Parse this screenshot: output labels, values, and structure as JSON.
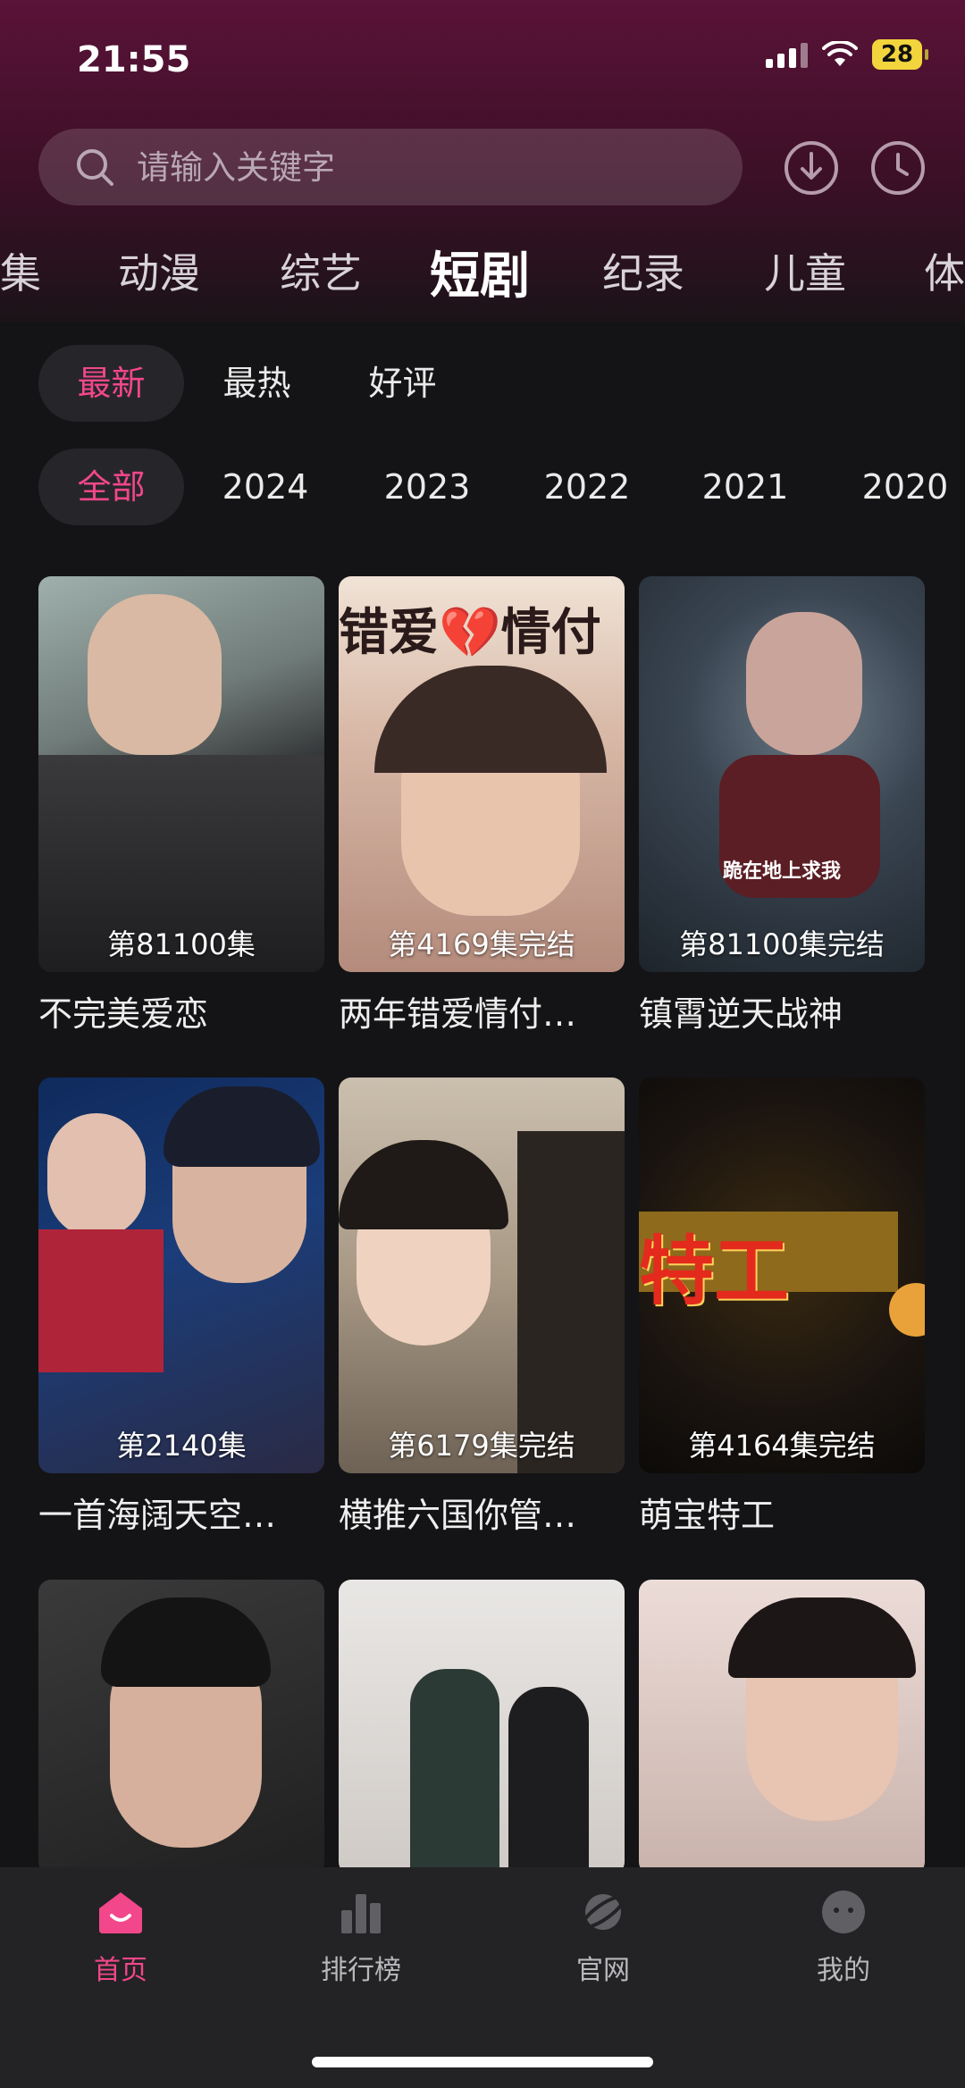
{
  "status_bar": {
    "time": "21:55",
    "battery": "28"
  },
  "search": {
    "placeholder": "请输入关键字"
  },
  "categories": [
    "集",
    "动漫",
    "综艺",
    "短剧",
    "纪录",
    "儿童",
    "体"
  ],
  "sort_filters": [
    "最新",
    "最热",
    "好评"
  ],
  "year_filters": [
    "全部",
    "2024",
    "2023",
    "2022",
    "2021",
    "2020"
  ],
  "cards": [
    {
      "episode": "第81100集",
      "title": "不完美爱恋"
    },
    {
      "episode": "第4169集完结",
      "title": "两年错爱情付…",
      "poster_text": "错爱💔情付"
    },
    {
      "episode": "第81100集完结",
      "title": "镇霄逆天战神",
      "poster_text": "跪在地上求我"
    },
    {
      "episode": "第2140集",
      "title": "一首海阔天空…"
    },
    {
      "episode": "第6179集完结",
      "title": "横推六国你管…"
    },
    {
      "episode": "第4164集完结",
      "title": "萌宝特工",
      "poster_text": "特工"
    },
    {
      "episode": "",
      "title": ""
    },
    {
      "episode": "",
      "title": ""
    },
    {
      "episode": "",
      "title": ""
    }
  ],
  "tabbar": [
    {
      "label": "首页",
      "icon": "home-icon"
    },
    {
      "label": "排行榜",
      "icon": "chart-icon"
    },
    {
      "label": "官网",
      "icon": "planet-icon"
    },
    {
      "label": "我的",
      "icon": "profile-icon"
    }
  ],
  "colors": {
    "accent": "#f2478a",
    "background": "#141416"
  }
}
